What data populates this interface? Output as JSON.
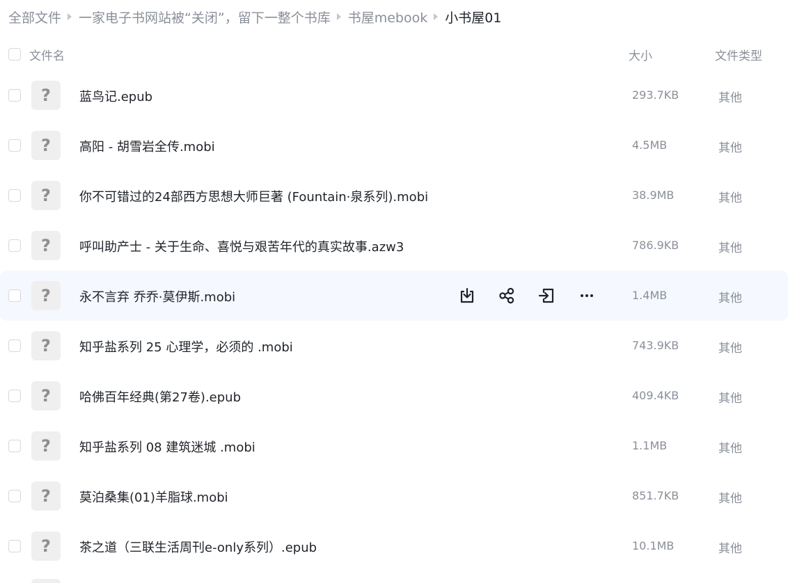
{
  "breadcrumb": [
    {
      "label": "全部文件",
      "current": false
    },
    {
      "label": "一家电子书网站被“关闭”，留下一整个书库",
      "current": false
    },
    {
      "label": "书屋mebook",
      "current": false
    },
    {
      "label": "小书屋01",
      "current": true
    }
  ],
  "header": {
    "name": "文件名",
    "size": "大小",
    "type": "文件类型"
  },
  "icons": {
    "file": "unknown-file-icon",
    "glyph": "?",
    "actions": [
      "download-icon",
      "share-icon",
      "move-icon",
      "more-icon"
    ]
  },
  "files": [
    {
      "name": "蓝鸟记.epub",
      "size": "293.7KB",
      "type": "其他",
      "hover": false
    },
    {
      "name": "高阳 - 胡雪岩全传.mobi",
      "size": "4.5MB",
      "type": "其他",
      "hover": false
    },
    {
      "name": "你不可错过的24部西方思想大师巨著 (Fountain·泉系列).mobi",
      "size": "38.9MB",
      "type": "其他",
      "hover": false
    },
    {
      "name": "呼叫助产士 - 关于生命、喜悦与艰苦年代的真实故事.azw3",
      "size": "786.9KB",
      "type": "其他",
      "hover": false
    },
    {
      "name": "永不言弃 乔乔·莫伊斯.mobi",
      "size": "1.4MB",
      "type": "其他",
      "hover": true
    },
    {
      "name": "知乎盐系列 25 心理学，必须的 .mobi",
      "size": "743.9KB",
      "type": "其他",
      "hover": false
    },
    {
      "name": "哈佛百年经典(第27卷).epub",
      "size": "409.4KB",
      "type": "其他",
      "hover": false
    },
    {
      "name": "知乎盐系列 08 建筑迷城 .mobi",
      "size": "1.1MB",
      "type": "其他",
      "hover": false
    },
    {
      "name": "莫泊桑集(01)羊脂球.mobi",
      "size": "851.7KB",
      "type": "其他",
      "hover": false
    },
    {
      "name": "茶之道（三联生活周刊e-only系列）.epub",
      "size": "10.1MB",
      "type": "其他",
      "hover": false
    }
  ]
}
